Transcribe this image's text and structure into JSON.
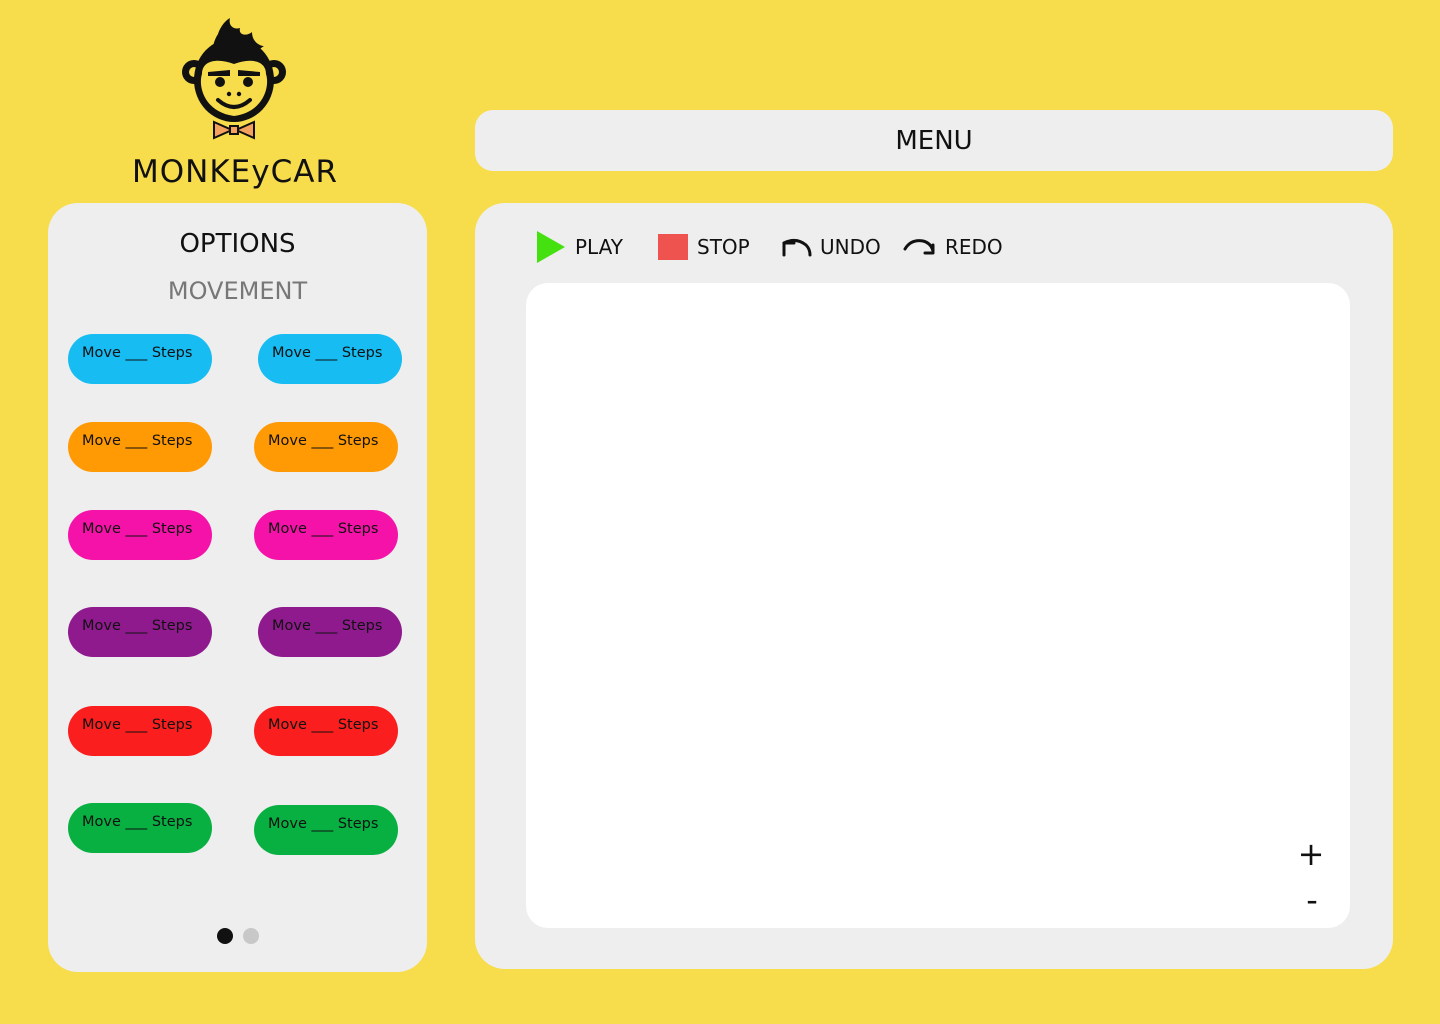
{
  "brand": {
    "name": "MONKEyCAR"
  },
  "menu": {
    "label": "MENU"
  },
  "options": {
    "title": "OPTIONS",
    "category": "MOVEMENT",
    "blocks": [
      {
        "label": "Move ___ Steps",
        "color": "#16BCF2"
      },
      {
        "label": "Move ___ Steps",
        "color": "#16BCF2"
      },
      {
        "label": "Move ___ Steps",
        "color": "#FF9A05"
      },
      {
        "label": "Move ___ Steps",
        "color": "#FF9A05"
      },
      {
        "label": "Move ___ Steps",
        "color": "#F512A9"
      },
      {
        "label": "Move ___ Steps",
        "color": "#F512A9"
      },
      {
        "label": "Move ___ Steps",
        "color": "#8E1A8E"
      },
      {
        "label": "Move ___ Steps",
        "color": "#8E1A8E"
      },
      {
        "label": "Move ___ Steps",
        "color": "#FA1E1E"
      },
      {
        "label": "Move ___ Steps",
        "color": "#FA1E1E"
      },
      {
        "label": "Move ___ Steps",
        "color": "#08B042"
      },
      {
        "label": "Move ___ Steps",
        "color": "#08B042"
      }
    ],
    "pager": {
      "pages": 2,
      "current": 1,
      "active_color": "#111111",
      "inactive_color": "#C8C8C8"
    }
  },
  "toolbar": {
    "play": {
      "label": "PLAY",
      "icon": "play-icon",
      "color": "#45E010"
    },
    "stop": {
      "label": "STOP",
      "icon": "stop-icon",
      "color": "#EF5350"
    },
    "undo": {
      "label": "UNDO",
      "icon": "undo-arrow-icon"
    },
    "redo": {
      "label": "REDO",
      "icon": "redo-arrow-icon"
    }
  },
  "canvas": {
    "zoom_in": "+",
    "zoom_out": "-"
  },
  "colors": {
    "background": "#F7DC4B",
    "panel": "#EEEEEE",
    "canvas": "#FFFFFF"
  }
}
